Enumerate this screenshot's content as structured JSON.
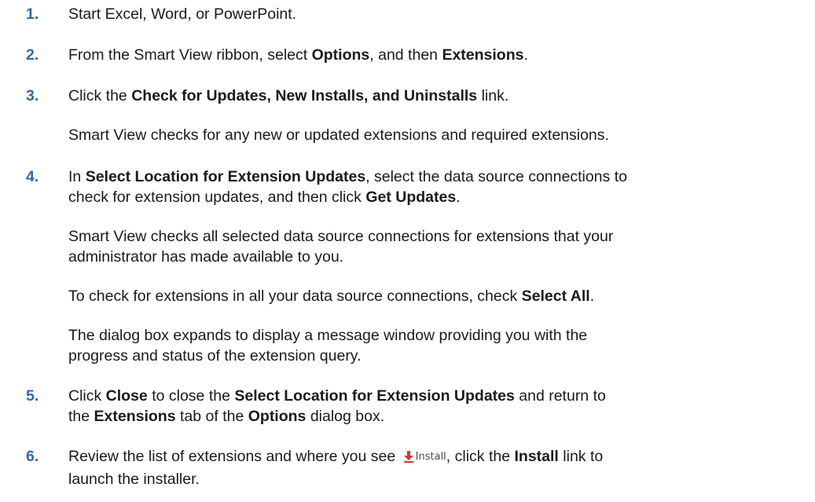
{
  "steps": [
    {
      "number": "1.",
      "parts": [
        "Start Excel, Word, or PowerPoint."
      ]
    },
    {
      "number": "2.",
      "parts": [
        "From the Smart View ribbon, select ",
        "Options",
        ", and then ",
        "Extensions",
        "."
      ]
    },
    {
      "number": "3.",
      "parts": [
        "Click the ",
        "Check for Updates, New Installs, and Uninstalls",
        " link."
      ],
      "note": "Smart View checks for any new or updated extensions and required extensions."
    },
    {
      "number": "4.",
      "line1": [
        "In ",
        "Select Location for Extension Updates",
        ", select the data source connections to"
      ],
      "line2": [
        "check for extension updates, and then click ",
        "Get Updates",
        "."
      ],
      "note1_l1": "Smart View checks all selected data source connections for extensions that your",
      "note1_l2": "administrator has made available to you.",
      "note2": [
        "To check for extensions in all your data source connections, check ",
        "Select All",
        "."
      ],
      "note3_l1": "The dialog box expands to display a message window providing you with the",
      "note3_l2": "progress and status of the extension query."
    },
    {
      "number": "5.",
      "line1": [
        "Click ",
        "Close",
        " to close the ",
        "Select Location for Extension Updates",
        " and return to"
      ],
      "line2": [
        "the ",
        "Extensions",
        " tab of the ",
        "Options",
        " dialog box."
      ]
    },
    {
      "number": "6.",
      "line1": [
        "Review the list of extensions and where you see ",
        ", click the ",
        "Install",
        " link to"
      ],
      "install_icon_label": "Install",
      "line2": "launch the installer."
    }
  ],
  "colors": {
    "step_number": "#2e6ba6",
    "install_icon": "#d9342b"
  }
}
